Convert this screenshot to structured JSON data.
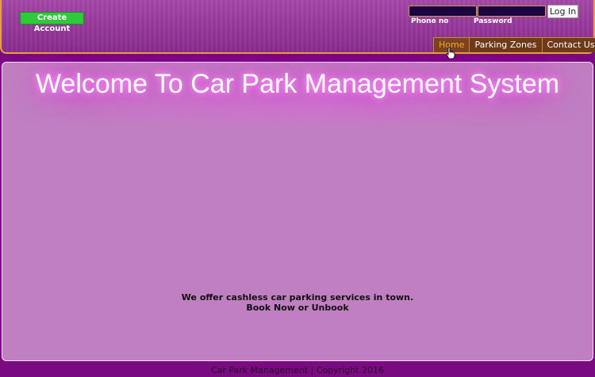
{
  "header": {
    "create_account_label": "Create Account",
    "login": {
      "phone_placeholder": "",
      "password_placeholder": "",
      "phone_label": "Phone no",
      "password_label": "Password",
      "login_button": "Log In"
    },
    "nav": [
      {
        "label": "Home",
        "active": true
      },
      {
        "label": "Parking Zones",
        "active": false
      },
      {
        "label": "Contact Us",
        "active": false
      }
    ]
  },
  "main": {
    "welcome_title": "Welcome To Car Park Management System",
    "offer_line1": "We offer cashless car parking services in town.",
    "offer_line2": "Book Now or Unbook"
  },
  "footer": {
    "text": "Car Park Management | Copyright 2016"
  },
  "colors": {
    "header_border": "#e8a23a",
    "create_button": "#2fc93a",
    "nav_active_text": "#f0a830",
    "main_bg": "#c07fc0",
    "page_bg": "#7a0a80"
  }
}
